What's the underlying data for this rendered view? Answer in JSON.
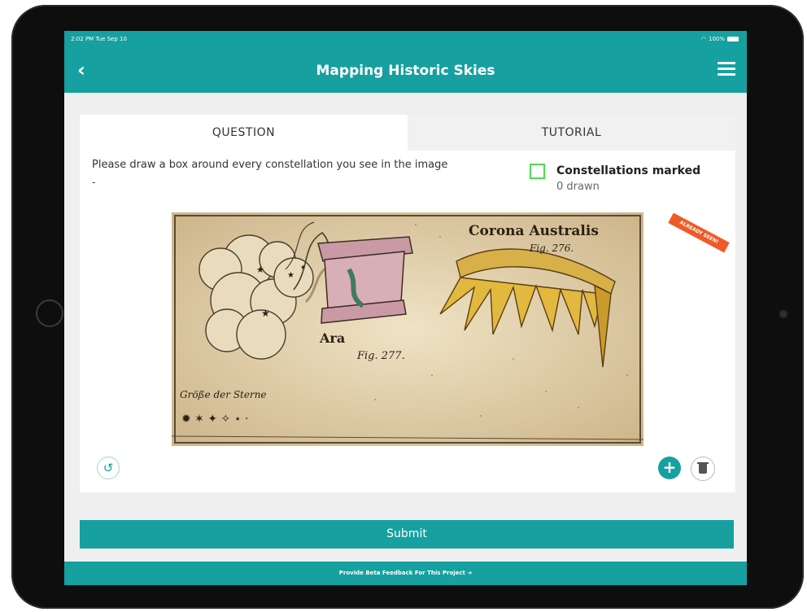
{
  "status_bar": {
    "time": "2:02 PM  Tue Sep 10",
    "battery": "100%"
  },
  "nav": {
    "back_icon": "chevron-left-icon",
    "title": "Mapping Historic Skies",
    "menu_icon": "hamburger-menu-icon"
  },
  "tabs": [
    {
      "label": "QUESTION",
      "active": true
    },
    {
      "label": "TUTORIAL",
      "active": false
    }
  ],
  "question": {
    "instruction": "Please draw a box around every constellation you see in the image",
    "dash": "-"
  },
  "task": {
    "label": "Constellations marked",
    "count": "0 drawn",
    "checkbox_color": "#4ddc52"
  },
  "subject": {
    "badge": "ALREADY SEEN!",
    "labels": {
      "corona": "Corona Australis",
      "corona_fig": "Fig. 276.",
      "ara": "Ara",
      "ara_fig": "Fig. 277.",
      "legend": "Größe der Sterne"
    }
  },
  "actions": {
    "undo_icon": "undo-icon",
    "add_icon": "plus-icon",
    "delete_icon": "trash-icon"
  },
  "submit": {
    "label": "Submit"
  },
  "footer": {
    "label": "Provide Beta Feedback For This Project  ➔"
  },
  "colors": {
    "teal": "#16a09f",
    "badge": "#ef5b26"
  }
}
